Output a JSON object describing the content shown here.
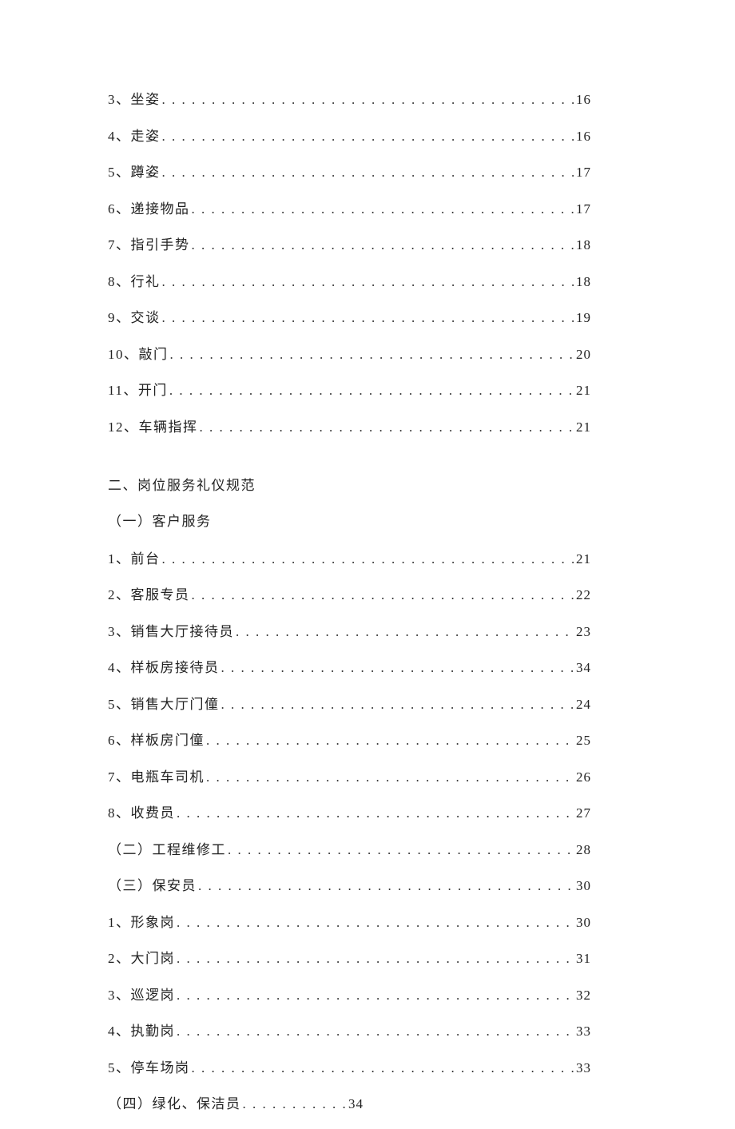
{
  "section1": [
    {
      "label": "3、坐姿",
      "page": "16"
    },
    {
      "label": "4、走姿",
      "page": "16"
    },
    {
      "label": "5、蹲姿",
      "page": "17"
    },
    {
      "label": "6、递接物品",
      "page": "17"
    },
    {
      "label": "7、指引手势",
      "page": "18"
    },
    {
      "label": "8、行礼",
      "page": "18"
    },
    {
      "label": "9、交谈",
      "page": "19"
    },
    {
      "label": "10、敲门",
      "page": "20"
    },
    {
      "label": "11、开门",
      "page": "21"
    },
    {
      "label": "12、车辆指挥",
      "page": "21"
    }
  ],
  "heading2": "二、岗位服务礼仪规范",
  "subheading2_1": "（一）客户服务",
  "section2_1": [
    {
      "label": "1、前台",
      "page": "21"
    },
    {
      "label": "2、客服专员",
      "page": "22"
    },
    {
      "label": "3、销售大厅接待员",
      "page": "23"
    },
    {
      "label": "4、样板房接待员",
      "page": "34"
    },
    {
      "label": "5、销售大厅门僮",
      "page": "24"
    },
    {
      "label": "6、样板房门僮",
      "page": "25"
    },
    {
      "label": "7、电瓶车司机",
      "page": "26"
    },
    {
      "label": "8、收费员",
      "page": "27"
    }
  ],
  "subheading2_2": {
    "label": "（二）工程维修工",
    "page": "28"
  },
  "subheading2_3": {
    "label": "（三）保安员",
    "page": "30"
  },
  "section2_3": [
    {
      "label": "1、形象岗",
      "page": "30"
    },
    {
      "label": "2、大门岗",
      "page": "31"
    },
    {
      "label": "3、巡逻岗",
      "page": "32"
    },
    {
      "label": "4、执勤岗",
      "page": "33"
    },
    {
      "label": "5、停车场岗",
      "page": "33"
    }
  ],
  "subheading2_4": {
    "label": "（四）绿化、保洁员",
    "page": "34"
  },
  "dots_long": ". . . . . . . . . . . . . . . . . . . . . . . . . . . . . . . . . . . . . . . . . . . . . . . . . . . . . . . . . . . . . . . . . . . . . . . . . . . .",
  "dots_short": ". . . . . . . . . . . . . . . . . . . . . . . . . . . . . . . . ."
}
